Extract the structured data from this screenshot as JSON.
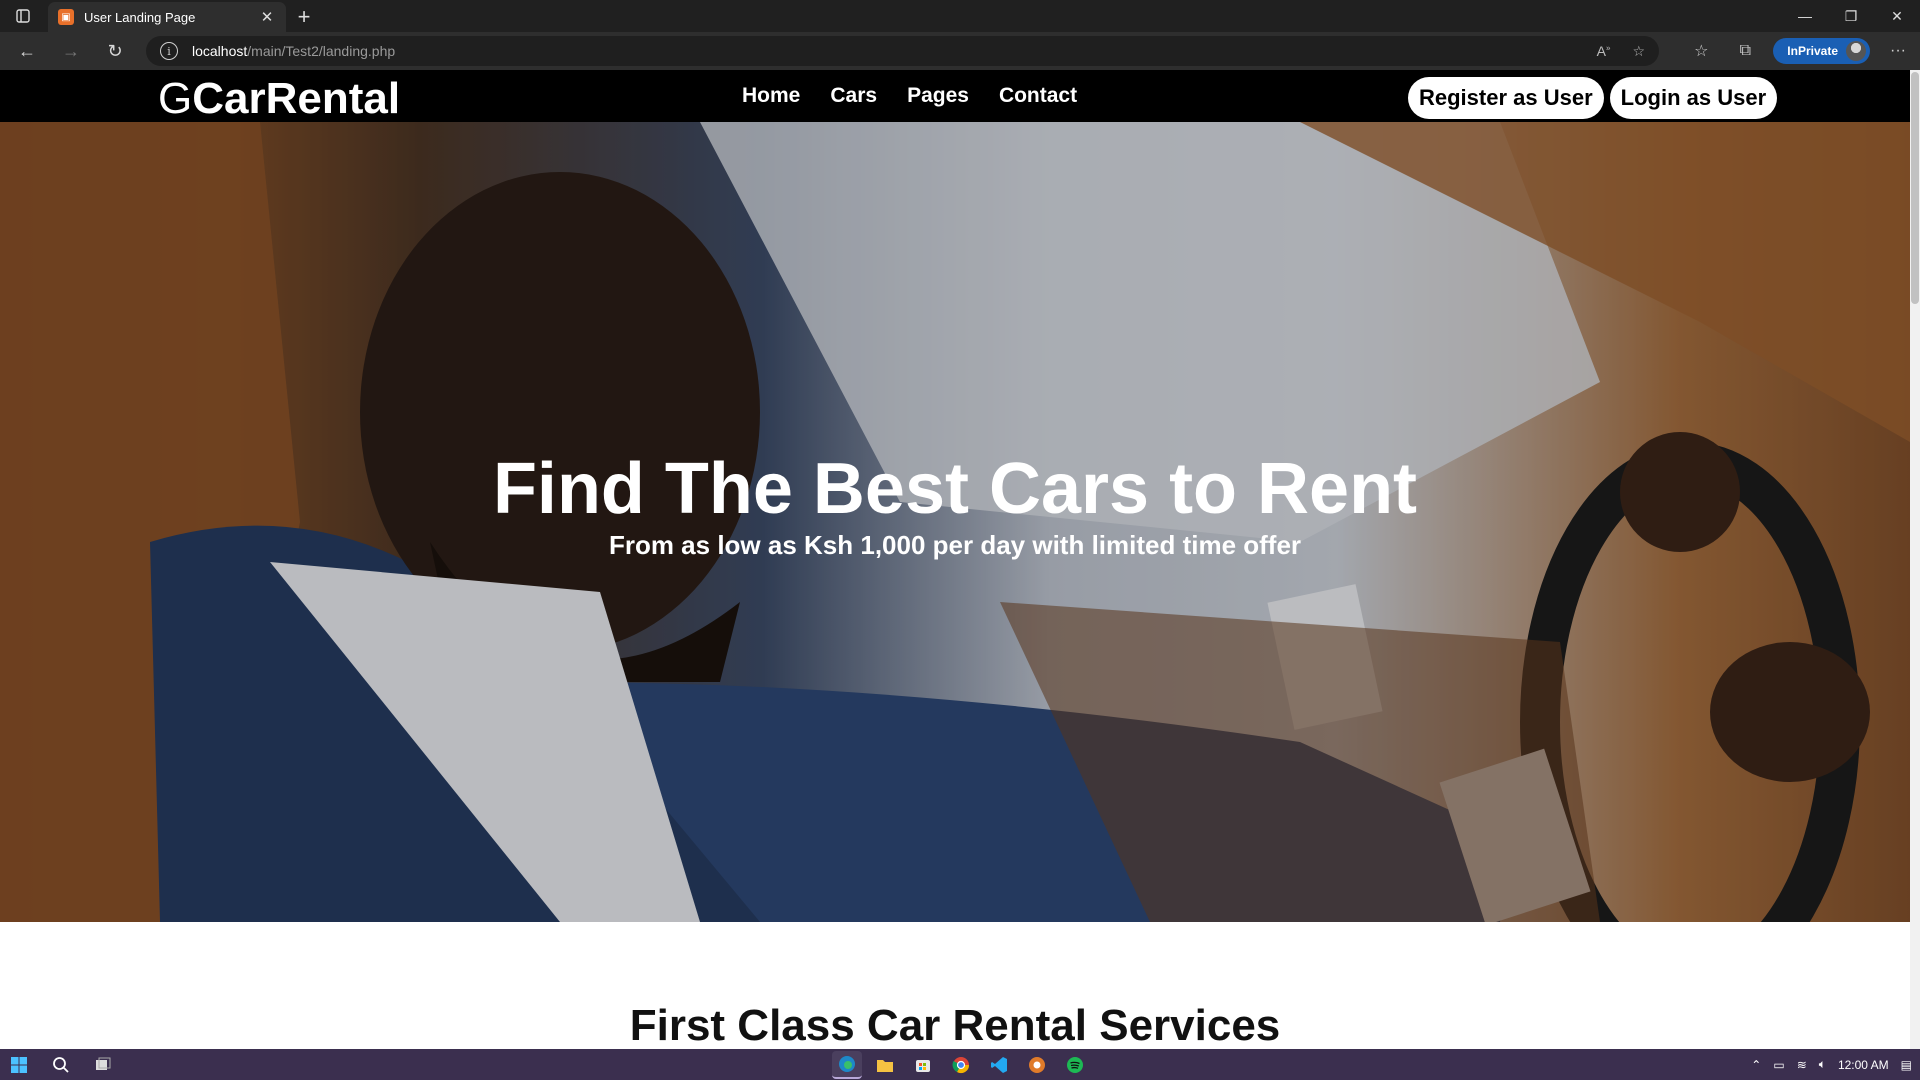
{
  "browser": {
    "tab_title": "User Landing Page",
    "url_host": "localhost",
    "url_path": "/main/Test2/landing.php",
    "inprivate_label": "InPrivate"
  },
  "site": {
    "logo": "CarRental",
    "logo_mark": "G",
    "nav": [
      "Home",
      "Cars",
      "Pages",
      "Contact"
    ],
    "register_label": "Register as User",
    "login_label": "Login as User"
  },
  "hero": {
    "headline": "Find The Best Cars to Rent",
    "subhead": "From as low as Ksh 1,000 per day with limited time offer"
  },
  "section": {
    "title": "First Class Car Rental Services"
  },
  "taskbar": {
    "clock": "12:00 AM"
  }
}
